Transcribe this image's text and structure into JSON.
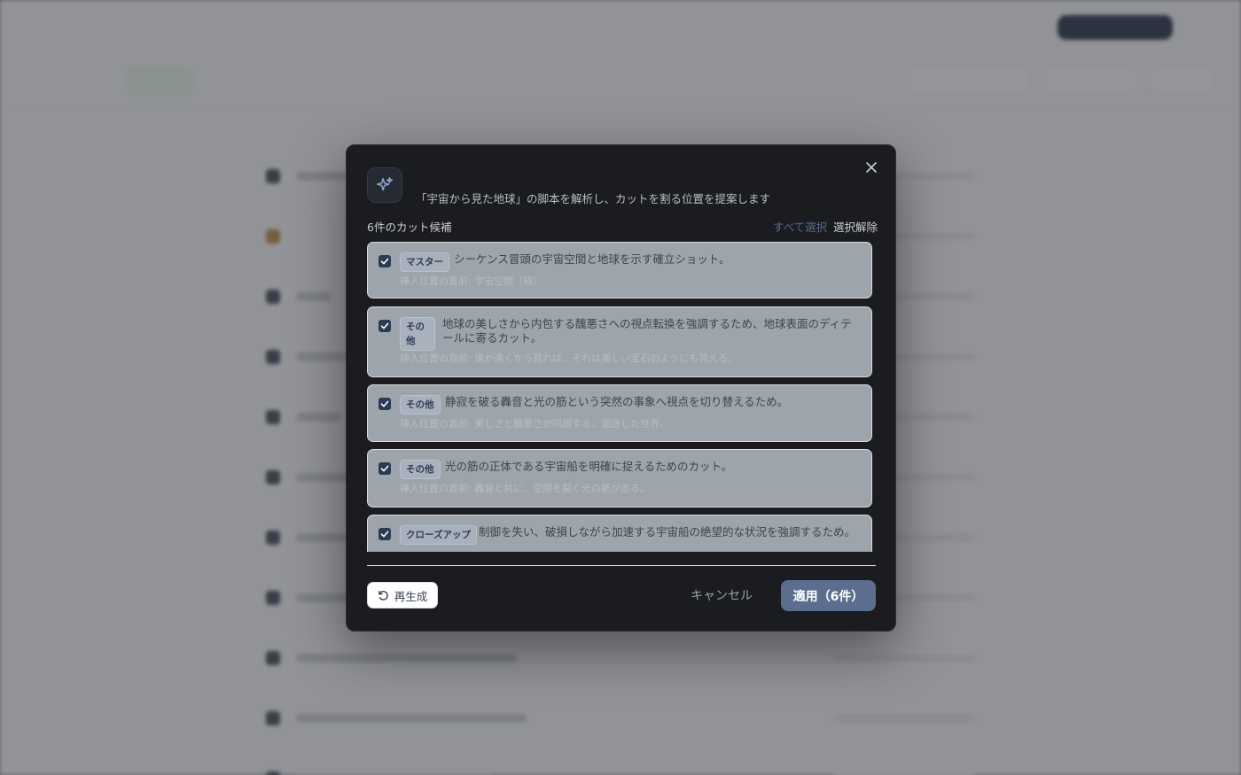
{
  "modal": {
    "title": "",
    "subtitle": "「宇宙から見た地球」の脚本を解析し、カットを割る位置を提案します",
    "count_label": "6件のカット候補",
    "select_all": "すべて選択",
    "deselect_all": "選択解除",
    "regenerate": "再生成",
    "cancel": "キャンセル",
    "apply": "適用（6件）",
    "icons": {
      "header": "sparkles-icon",
      "close": "close-icon",
      "regenerate": "refresh-icon",
      "checkbox": "check-icon"
    },
    "colors": {
      "apply_button": "#5c6e90",
      "card_background": "#9ea4ab",
      "checkbox": "#2b3a55",
      "select_all_link": "#5a6a8e"
    },
    "cards": [
      {
        "checked": true,
        "tag": "マスター",
        "text": "シーケンス冒頭の宇宙空間と地球を示す確立ショット。",
        "sub": "挿入位置の直前: 宇宙空間（暗）"
      },
      {
        "checked": true,
        "tag": "その他",
        "text": "地球の美しさから内包する醜悪さへの視点転換を強調するため、地球表面のディテールに寄るカット。",
        "sub": "挿入位置の直前: 遠か遠くから見れば、それは美しい宝石のようにも見える。"
      },
      {
        "checked": true,
        "tag": "その他",
        "text": "静寂を破る轟音と光の筋という突然の事象へ視点を切り替えるため。",
        "sub": "挿入位置の直前: 美しさと醜悪さが同居する、混迷した世界。"
      },
      {
        "checked": true,
        "tag": "その他",
        "text": "光の筋の正体である宇宙船を明確に捉えるためのカット。",
        "sub": "挿入位置の直前: 轟音と共に、空間を裂く光の筋が走る。"
      },
      {
        "checked": true,
        "tag": "クローズアップ",
        "text": "制御を失い、破損しながら加速する宇宙船の絶望的な状況を強調するため。",
        "sub": ""
      }
    ]
  }
}
